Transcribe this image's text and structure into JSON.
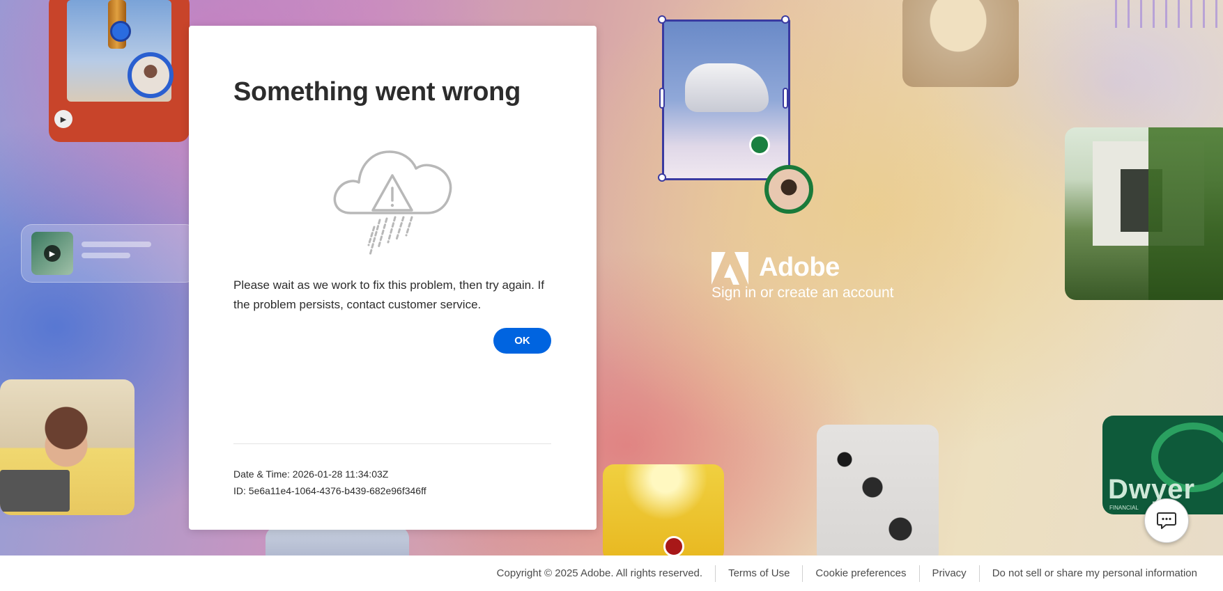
{
  "modal": {
    "title": "Something went wrong",
    "message": "Please wait as we work to fix this problem, then try again. If the problem persists, contact customer service.",
    "ok_label": "OK",
    "datetime": "Date & Time: 2026-01-28 11:34:03Z",
    "id": "ID: 5e6a11e4-1064-4376-b439-682e96f346ff"
  },
  "brand": {
    "name": "Adobe",
    "subtitle": "Sign in or create an account",
    "logo_color": "#ffffff"
  },
  "background_card_text": {
    "green_card_word": "Dwyer",
    "green_card_subtext": "FINANCIAL"
  },
  "chat": {
    "icon": "chat-bubble-icon"
  },
  "footer": {
    "copyright": "Copyright © 2025 Adobe. All rights reserved.",
    "links": [
      "Terms of Use",
      "Cookie preferences",
      "Privacy",
      "Do not sell or share my personal information"
    ]
  },
  "colors": {
    "primary_button": "#0064e0",
    "modal_background": "#ffffff",
    "text": "#2c2c2c",
    "footer_text": "#4b4b4b"
  }
}
